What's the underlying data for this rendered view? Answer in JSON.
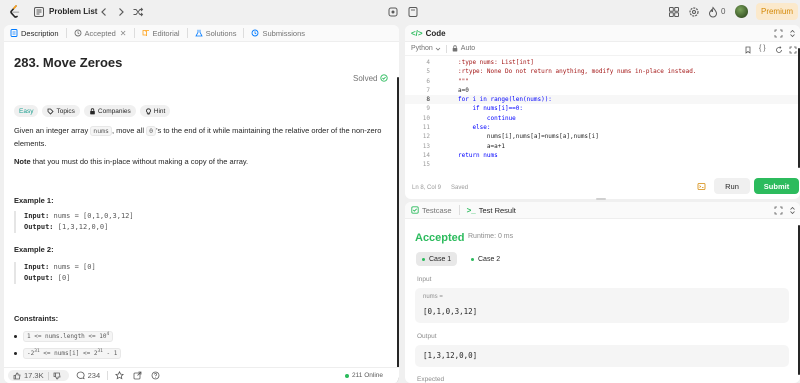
{
  "topbar": {
    "problem_list": "Problem List",
    "premium": "Premium",
    "streak": "0"
  },
  "left_tabs": [
    "Description",
    "Accepted",
    "Editorial",
    "Solutions",
    "Submissions"
  ],
  "problem": {
    "title": "283. Move Zeroes",
    "status": "Solved",
    "difficulty": "Easy",
    "tags": [
      "Topics",
      "Companies",
      "Hint"
    ],
    "desc_pre": "Given an integer array ",
    "desc_code1": "nums",
    "desc_mid": ", move all ",
    "desc_code2": "0",
    "desc_post": "'s to the end of it while maintaining the relative order of the non-zero elements.",
    "note_bold": "Note",
    "note_rest": " that you must do this in-place without making a copy of the array.",
    "example1_title": "Example 1:",
    "example1_input_label": "Input:",
    "example1_input": " nums = [0,1,0,3,12]",
    "example1_output_label": "Output:",
    "example1_output": " [1,3,12,0,0]",
    "example2_title": "Example 2:",
    "example2_input_label": "Input:",
    "example2_input": " nums = [0]",
    "example2_output_label": "Output:",
    "example2_output": " [0]",
    "constraints_title": "Constraints:",
    "constraint1_a": "1 <= nums.length <= 10",
    "constraint1_sup": "4",
    "constraint2_a": "-2",
    "constraint2_sup1": "31",
    "constraint2_b": " <= nums[i] <= 2",
    "constraint2_sup2": "31",
    "constraint2_c": " - 1"
  },
  "bottom": {
    "likes": "17.3K",
    "comments": "234",
    "online": "211 Online"
  },
  "code": {
    "header": "Code",
    "language": "Python",
    "auto": "Auto",
    "cursor": "Ln 8, Col 9",
    "saved": "Saved",
    "run": "Run",
    "submit": "Submit",
    "lines": [
      {
        "n": "4",
        "text": ":type nums: List[int]"
      },
      {
        "n": "5",
        "text": ":rtype: None Do not return anything, modify nums in-place instead."
      },
      {
        "n": "6",
        "text": "\"\"\""
      },
      {
        "n": "7",
        "text": "a=0"
      },
      {
        "n": "8",
        "text": "for i in range(len(nums)):"
      },
      {
        "n": "9",
        "text": "    if nums[i]==0:"
      },
      {
        "n": "10",
        "text": "        continue"
      },
      {
        "n": "11",
        "text": "    else:"
      },
      {
        "n": "12",
        "text": "        nums[i],nums[a]=nums[a],nums[i]"
      },
      {
        "n": "13",
        "text": "        a=a+1"
      },
      {
        "n": "14",
        "text": "return nums"
      },
      {
        "n": "15",
        "text": ""
      }
    ]
  },
  "result": {
    "testcase_tab": "Testcase",
    "result_tab": "Test Result",
    "status": "Accepted",
    "runtime": "Runtime: 0 ms",
    "case1": "Case 1",
    "case2": "Case 2",
    "input_label": "Input",
    "input_var": "nums =",
    "input_value": "[0,1,0,3,12]",
    "output_label": "Output",
    "output_value": "[1,3,12,0,0]",
    "expected_label": "Expected"
  },
  "colors": {
    "accent_green": "#2cbb5d",
    "premium_orange": "#d48806",
    "easy_teal": "#1a9e8f"
  }
}
